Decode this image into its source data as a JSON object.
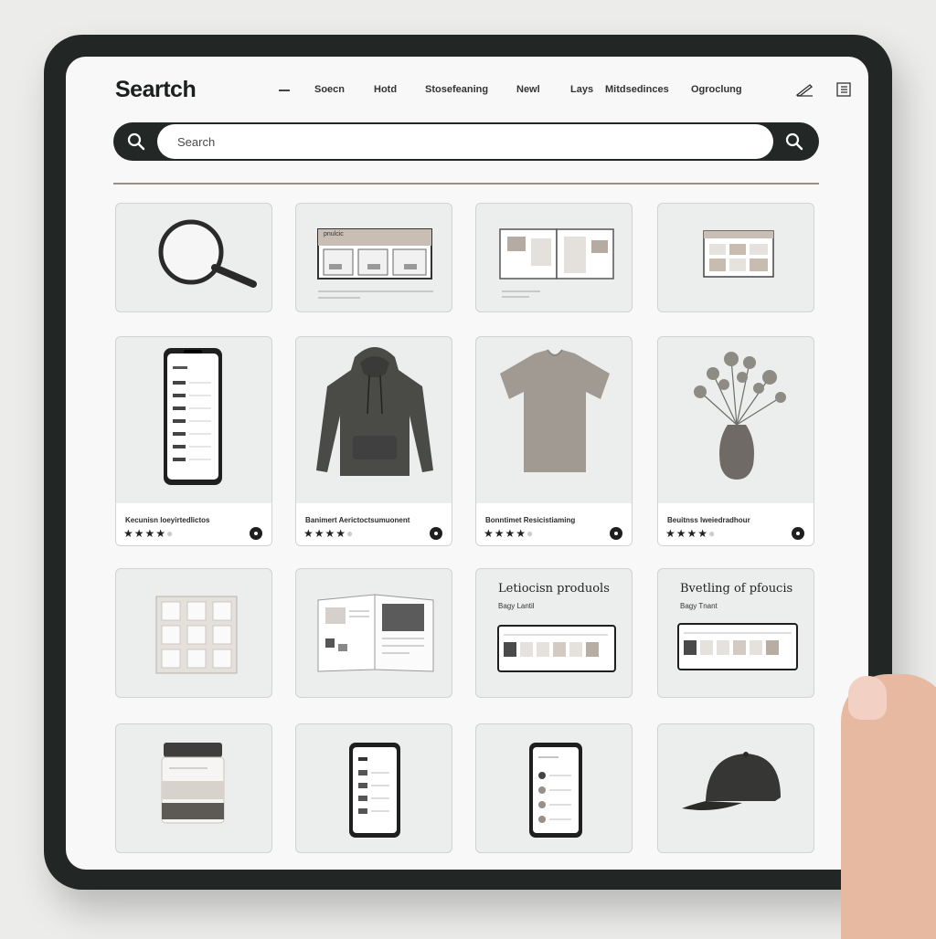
{
  "header": {
    "logo": "Seartch",
    "nav": [
      "Soecn",
      "Hotd",
      "Stosefeaning",
      "Newl",
      "Lays",
      "Mitdsedinces",
      "Ogroclung"
    ]
  },
  "search": {
    "placeholder": "Search"
  },
  "row1": [
    {
      "kind": "magnifier-illustration"
    },
    {
      "kind": "dashboard-mockup",
      "label": "pnulcic"
    },
    {
      "kind": "open-catalog"
    },
    {
      "kind": "dashboard-mockup-small"
    }
  ],
  "products": [
    {
      "title": "Kecunisn loeyirtedlictos",
      "stars": 4,
      "image": "phone-mockup"
    },
    {
      "title": "Banimert Aerictoctsumuonent",
      "stars": 4,
      "image": "hoodie"
    },
    {
      "title": "Bonntimet Resicistiaming",
      "stars": 4,
      "image": "tshirt"
    },
    {
      "title": "Beuitnss lweiedradhour",
      "stars": 4,
      "image": "vase"
    }
  ],
  "row3": [
    {
      "kind": "tile-grid"
    },
    {
      "kind": "open-book"
    },
    {
      "kind": "panel",
      "title": "Letiocisn produols",
      "subtitle": "Bagy Lantil"
    },
    {
      "kind": "panel",
      "title": "Bvetling of pfoucis",
      "subtitle": "Bagy Tnant"
    }
  ],
  "row4": [
    {
      "kind": "jar"
    },
    {
      "kind": "phone-small"
    },
    {
      "kind": "phone-small-2"
    },
    {
      "kind": "cap"
    }
  ],
  "colors": {
    "frame": "#222624",
    "screen": "#f7f8f7",
    "card": "#eceeed",
    "accent": "#9a8f86"
  }
}
